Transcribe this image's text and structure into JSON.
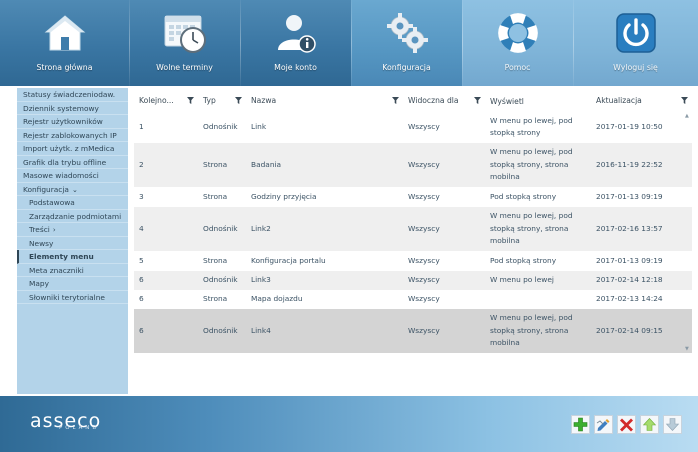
{
  "nav": [
    {
      "label": "Strona główna",
      "icon": "home-icon"
    },
    {
      "label": "Wolne terminy",
      "icon": "calendar-clock-icon"
    },
    {
      "label": "Moje konto",
      "icon": "user-info-icon"
    },
    {
      "label": "Konfiguracja",
      "icon": "gears-icon"
    },
    {
      "label": "Pomoc",
      "icon": "lifebuoy-icon"
    },
    {
      "label": "Wyloguj się",
      "icon": "power-icon"
    }
  ],
  "sidebar": [
    {
      "label": "Statusy świadczeniodaw."
    },
    {
      "label": "Dziennik systemowy"
    },
    {
      "label": "Rejestr użytkowników"
    },
    {
      "label": "Rejestr zablokowanych IP"
    },
    {
      "label": "Import użytk. z mMedica"
    },
    {
      "label": "Grafik dla trybu offline"
    },
    {
      "label": "Masowe wiadomości"
    },
    {
      "label": "Konfiguracja"
    },
    {
      "label": "Podstawowa"
    },
    {
      "label": "Zarządzanie podmiotami"
    },
    {
      "label": "Treści"
    },
    {
      "label": "Newsy"
    },
    {
      "label": "Elementy menu"
    },
    {
      "label": "Meta znaczniki"
    },
    {
      "label": "Mapy"
    },
    {
      "label": "Słowniki terytorialne"
    }
  ],
  "table": {
    "headers": [
      "Kolejno...",
      "Typ",
      "Nazwa",
      "Widoczna dla",
      "Wyświetl",
      "Aktualizacja"
    ],
    "rows": [
      {
        "order": "1",
        "type": "Odnośnik",
        "name": "Link",
        "visible": "Wszyscy",
        "display": "W menu po lewej, pod stopką strony",
        "updated": "2017-01-19 10:50"
      },
      {
        "order": "2",
        "type": "Strona",
        "name": "Badania",
        "visible": "Wszyscy",
        "display": "W menu po lewej, pod stopką strony, strona mobilna",
        "updated": "2016-11-19 22:52"
      },
      {
        "order": "3",
        "type": "Strona",
        "name": "Godziny przyjęcia",
        "visible": "Wszyscy",
        "display": "Pod stopką strony",
        "updated": "2017-01-13 09:19"
      },
      {
        "order": "4",
        "type": "Odnośnik",
        "name": "Link2",
        "visible": "Wszyscy",
        "display": "W menu po lewej, pod stopką strony, strona mobilna",
        "updated": "2017-02-16 13:57"
      },
      {
        "order": "5",
        "type": "Strona",
        "name": "Konfiguracja portalu",
        "visible": "Wszyscy",
        "display": "Pod stopką strony",
        "updated": "2017-01-13 09:19"
      },
      {
        "order": "6",
        "type": "Odnośnik",
        "name": "Link3",
        "visible": "Wszyscy",
        "display": "W menu po lewej",
        "updated": "2017-02-14 12:18"
      },
      {
        "order": "6",
        "type": "Strona",
        "name": "Mapa dojazdu",
        "visible": "Wszyscy",
        "display": "",
        "updated": "2017-02-13 14:24"
      },
      {
        "order": "6",
        "type": "Odnośnik",
        "name": "Link4",
        "visible": "Wszyscy",
        "display": "W menu po lewej, pod stopką strony, strona mobilna",
        "updated": "2017-02-14 09:15"
      }
    ]
  },
  "footer": {
    "logo": "asseco",
    "logo_sub": "POLAND",
    "buttons": [
      "add-icon",
      "edit-icon",
      "delete-icon",
      "move-up-icon",
      "move-down-icon"
    ]
  },
  "colors": {
    "accent": "#3a76a3",
    "sidebar": "#b3d3e9",
    "selected_row": "#d4d4d4",
    "add": "#3cae2e",
    "delete": "#d22a2a"
  }
}
